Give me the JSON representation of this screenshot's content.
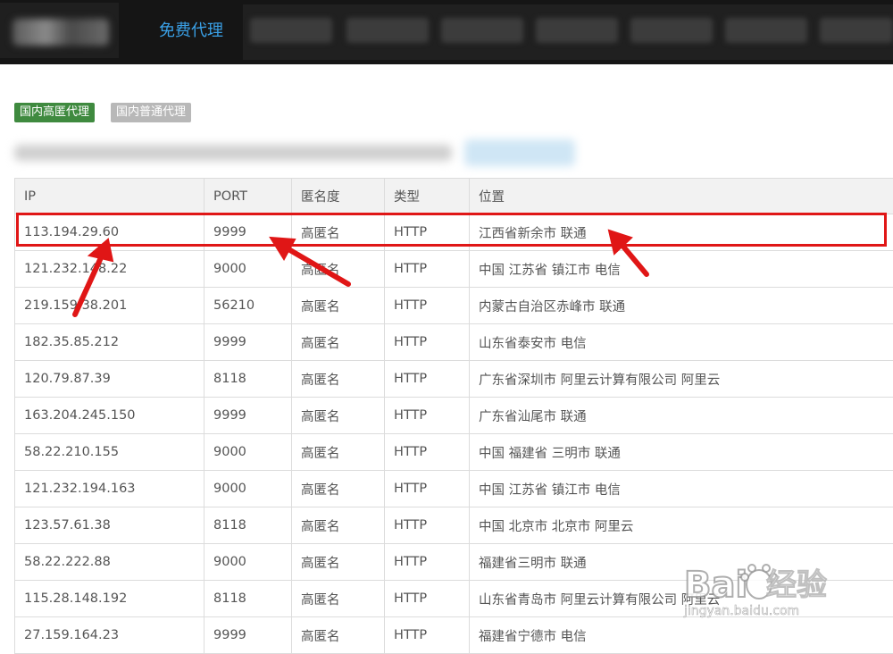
{
  "nav": {
    "active_label": "免费代理"
  },
  "tags": {
    "high_anon": "国内高匿代理",
    "normal": "国内普通代理"
  },
  "table": {
    "headers": [
      "IP",
      "PORT",
      "匿名度",
      "类型",
      "位置"
    ],
    "rows": [
      [
        "113.194.29.60",
        "9999",
        "高匿名",
        "HTTP",
        "江西省新余市 联通"
      ],
      [
        "121.232.148.22",
        "9000",
        "高匿名",
        "HTTP",
        "中国 江苏省 镇江市 电信"
      ],
      [
        "219.159.38.201",
        "56210",
        "高匿名",
        "HTTP",
        "内蒙古自治区赤峰市 联通"
      ],
      [
        "182.35.85.212",
        "9999",
        "高匿名",
        "HTTP",
        "山东省泰安市 电信"
      ],
      [
        "120.79.87.39",
        "8118",
        "高匿名",
        "HTTP",
        "广东省深圳市 阿里云计算有限公司 阿里云"
      ],
      [
        "163.204.245.150",
        "9999",
        "高匿名",
        "HTTP",
        "广东省汕尾市 联通"
      ],
      [
        "58.22.210.155",
        "9000",
        "高匿名",
        "HTTP",
        "中国 福建省 三明市 联通"
      ],
      [
        "121.232.194.163",
        "9000",
        "高匿名",
        "HTTP",
        "中国 江苏省 镇江市 电信"
      ],
      [
        "123.57.61.38",
        "8118",
        "高匿名",
        "HTTP",
        "中国 北京市 北京市 阿里云"
      ],
      [
        "58.22.222.88",
        "9000",
        "高匿名",
        "HTTP",
        "福建省三明市 联通"
      ],
      [
        "115.28.148.192",
        "8118",
        "高匿名",
        "HTTP",
        "山东省青岛市 阿里云计算有限公司 阿里云"
      ],
      [
        "27.159.164.23",
        "9999",
        "高匿名",
        "HTTP",
        "福建省宁德市 电信"
      ]
    ]
  },
  "watermark": {
    "brand_cn": "经验",
    "url": "jingyan.baidu.com"
  },
  "colors": {
    "accent": "#3aa0e6",
    "tag_green": "#3f8a3f",
    "highlight": "#e01616"
  }
}
